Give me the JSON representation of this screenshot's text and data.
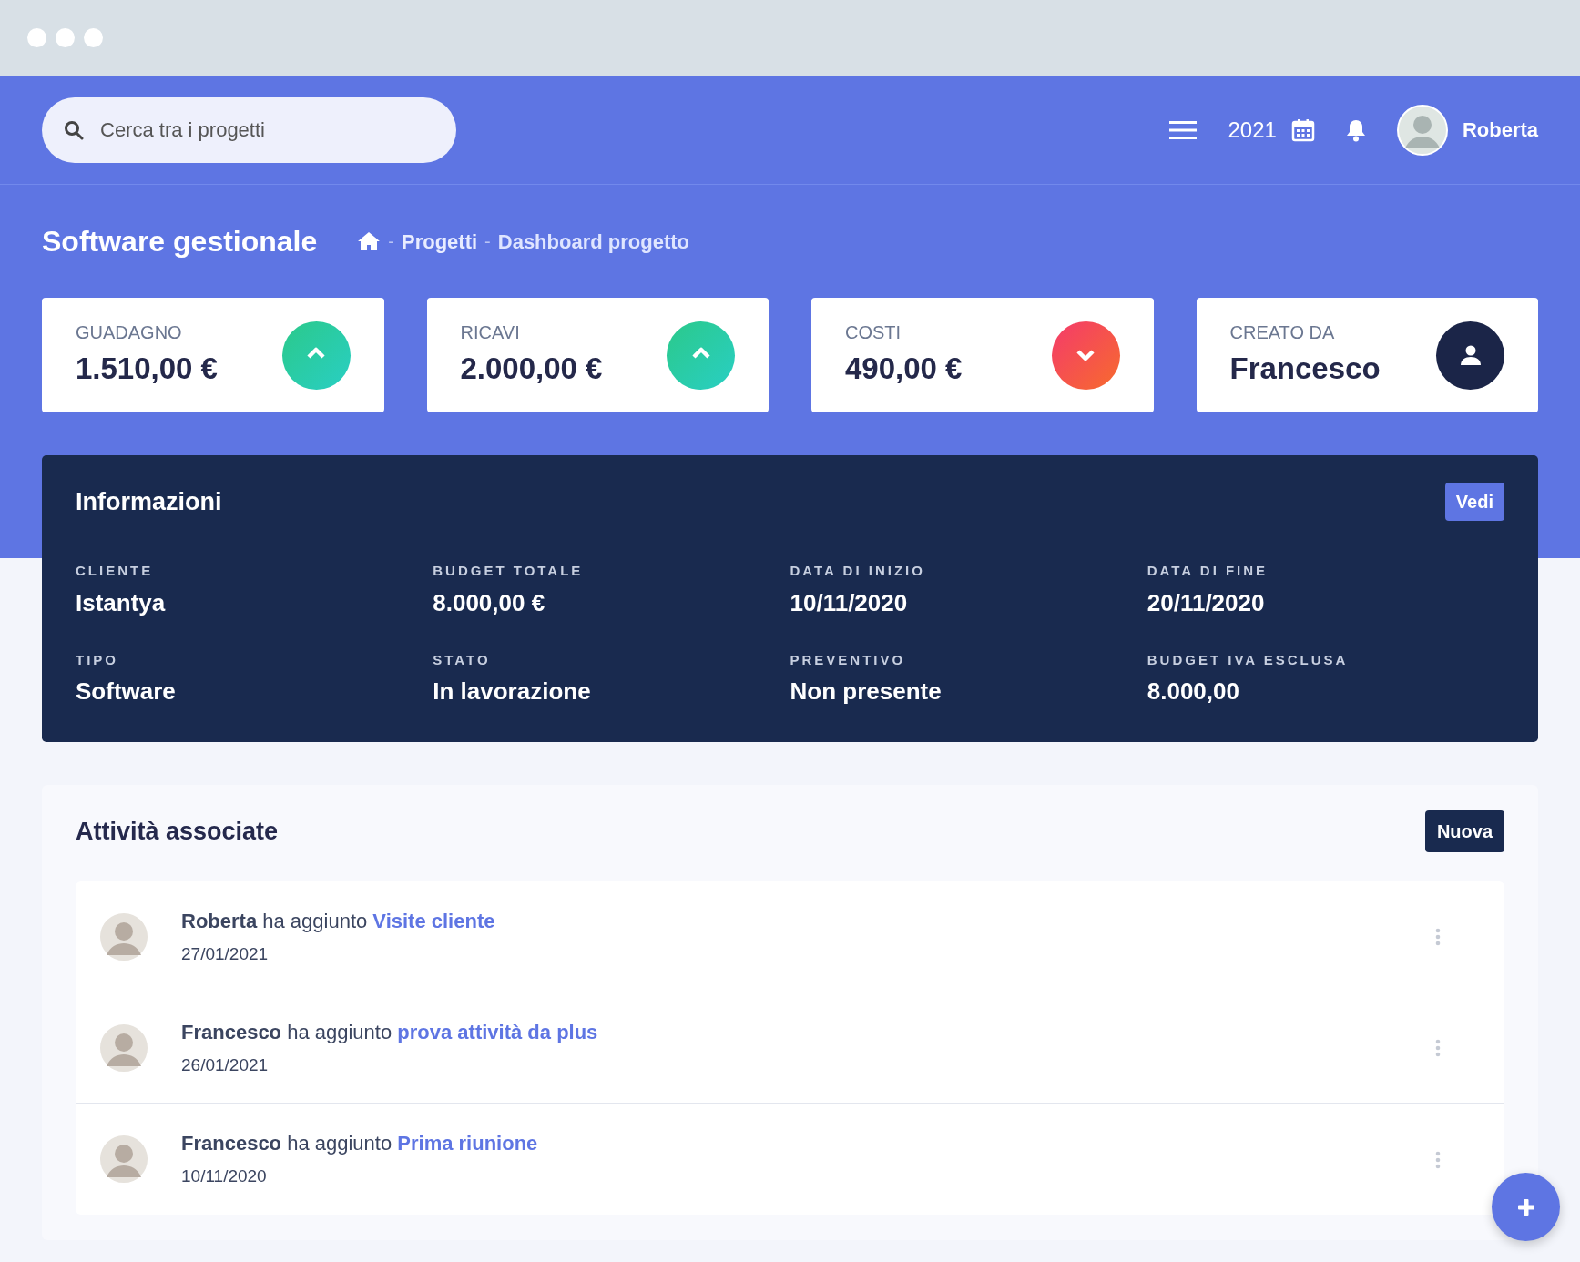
{
  "search": {
    "placeholder": "Cerca tra i progetti"
  },
  "topbar": {
    "year": "2021",
    "user": "Roberta"
  },
  "page": {
    "title": "Software gestionale",
    "separator": "-",
    "breadcrumb": [
      "Progetti",
      "Dashboard progetto"
    ]
  },
  "stats": [
    {
      "label": "GUADAGNO",
      "value": "1.510,00 €",
      "kind": "up"
    },
    {
      "label": "RICAVI",
      "value": "2.000,00 €",
      "kind": "up"
    },
    {
      "label": "COSTI",
      "value": "490,00 €",
      "kind": "down"
    },
    {
      "label": "CREATO DA",
      "value": "Francesco",
      "kind": "user"
    }
  ],
  "info": {
    "title": "Informazioni",
    "button": "Vedi",
    "fields": [
      {
        "label": "CLIENTE",
        "value": "Istantya"
      },
      {
        "label": "BUDGET TOTALE",
        "value": "8.000,00 €"
      },
      {
        "label": "DATA DI INIZIO",
        "value": "10/11/2020"
      },
      {
        "label": "DATA DI FINE",
        "value": "20/11/2020"
      },
      {
        "label": "TIPO",
        "value": "Software"
      },
      {
        "label": "STATO",
        "value": "In lavorazione"
      },
      {
        "label": "PREVENTIVO",
        "value": "Non presente"
      },
      {
        "label": "BUDGET IVA ESCLUSA",
        "value": "8.000,00"
      }
    ]
  },
  "activities": {
    "title": "Attività associate",
    "button": "Nuova",
    "items": [
      {
        "text": "**Roberta** ha aggiunto",
        "link": "Visite cliente",
        "date": "27/01/2021"
      },
      {
        "text": "**Francesco** ha aggiunto",
        "link": "prova attività da plus",
        "date": "26/01/2021"
      },
      {
        "text": "**Francesco** ha aggiunto",
        "link": "Prima riunione",
        "date": "10/11/2020"
      }
    ]
  }
}
